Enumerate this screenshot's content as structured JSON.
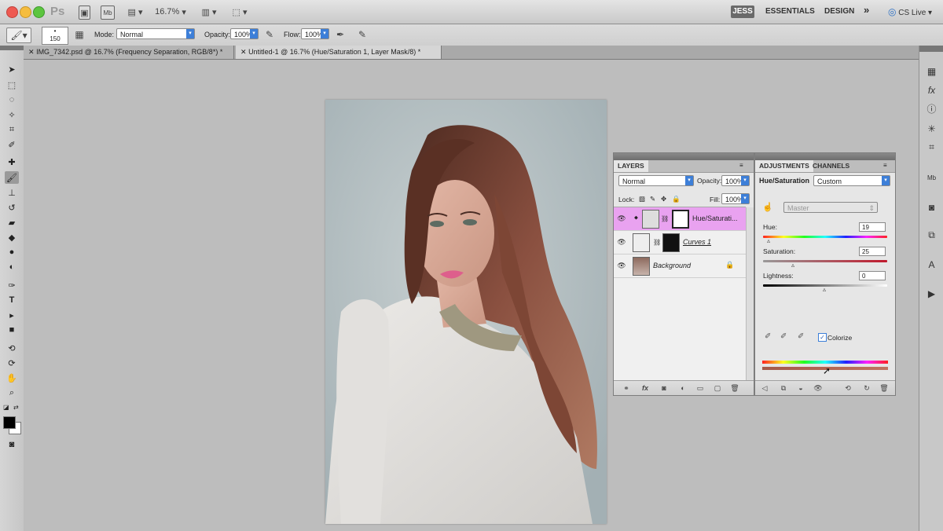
{
  "appbar": {
    "logo": "Ps",
    "zoom": "16.7%",
    "workspaces": [
      "JESS",
      "ESSENTIALS",
      "DESIGN"
    ],
    "more": "»",
    "cs_live": "CS Live"
  },
  "options": {
    "brush_size": "150",
    "mode_label": "Mode:",
    "mode_value": "Normal",
    "opacity_label": "Opacity:",
    "opacity_value": "100%",
    "flow_label": "Flow:",
    "flow_value": "100%"
  },
  "tabs": [
    {
      "label": "IMG_7342.psd @ 16.7% (Frequency Separation, RGB/8*) *"
    },
    {
      "label": "Untitled-1 @ 16.7% (Hue/Saturation 1, Layer Mask/8) *"
    }
  ],
  "layers_panel": {
    "tab": "LAYERS",
    "blend_mode": "Normal",
    "opacity_label": "Opacity:",
    "opacity_value": "100%",
    "lock_label": "Lock:",
    "fill_label": "Fill:",
    "fill_value": "100%",
    "layers": [
      {
        "name": "Hue/Saturati...",
        "selected": true
      },
      {
        "name": "Curves 1",
        "selected": false
      },
      {
        "name": "Background",
        "selected": false
      }
    ]
  },
  "adjustments_panel": {
    "tabs": [
      "ADJUSTMENTS",
      "CHANNELS"
    ],
    "title": "Hue/Saturation",
    "preset": "Custom",
    "channel": "Master",
    "hue_label": "Hue:",
    "hue_value": "19",
    "saturation_label": "Saturation:",
    "saturation_value": "25",
    "lightness_label": "Lightness:",
    "lightness_value": "0",
    "colorize_label": "Colorize",
    "colorize_checked": true
  },
  "colors": {
    "selected_layer": "#e9a2f0",
    "accent_blue": "#3d7fd8"
  }
}
